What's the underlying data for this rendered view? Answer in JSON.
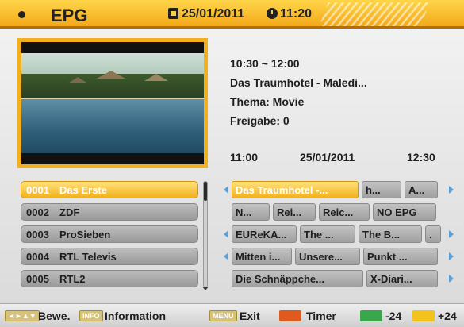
{
  "header": {
    "title": "EPG",
    "date": "25/01/2011",
    "time": "11:20",
    "icons": [
      "bullet-icon",
      "calendar-icon",
      "clock-icon"
    ]
  },
  "program": {
    "time_range": "10:30 ~ 12:00",
    "title": "Das Traumhotel - Maledi...",
    "thema": "Thema: Movie",
    "freigabe": "Freigabe: 0"
  },
  "timeline": {
    "start": "11:00",
    "date": "25/01/2011",
    "end": "12:30"
  },
  "channels": [
    {
      "num": "0001",
      "name": "Das Erste",
      "selected": true
    },
    {
      "num": "0002",
      "name": "ZDF",
      "selected": false
    },
    {
      "num": "0003",
      "name": "ProSieben",
      "selected": false
    },
    {
      "num": "0004",
      "name": "RTL Televis",
      "selected": false
    },
    {
      "num": "0005",
      "name": "RTL2",
      "selected": false
    }
  ],
  "grid": [
    {
      "left_arrow": true,
      "right_arrow": true,
      "cells": [
        "Das Traumhotel -...",
        "h...",
        "A..."
      ]
    },
    {
      "left_arrow": false,
      "right_arrow": false,
      "cells": [
        "N...",
        "Rei...",
        "Reic...",
        "NO EPG"
      ]
    },
    {
      "left_arrow": true,
      "right_arrow": true,
      "cells": [
        "EUReKA...",
        "The ...",
        "The B...",
        "."
      ]
    },
    {
      "left_arrow": true,
      "right_arrow": true,
      "cells": [
        "Mitten i...",
        "Unsere...",
        "Punkt ..."
      ]
    },
    {
      "left_arrow": false,
      "right_arrow": true,
      "cells": [
        "Die Schnäppche...",
        "X-Diari..."
      ]
    }
  ],
  "footer": {
    "move_badge": "◄►▲▼",
    "move_label": "Bewe.",
    "info_badge": "INFO",
    "info_label": "Information",
    "menu_badge": "MENU",
    "exit_label": "Exit",
    "timer_label": "Timer",
    "minus_label": "-24",
    "plus_label": "+24",
    "colors": {
      "red": "#e0591e",
      "green": "#3aa84a",
      "yellow": "#f2c21d"
    }
  },
  "colors": {
    "accent": "#f2b11f",
    "selected_text": "#ffffff",
    "arrow": "#5aa0d8"
  }
}
